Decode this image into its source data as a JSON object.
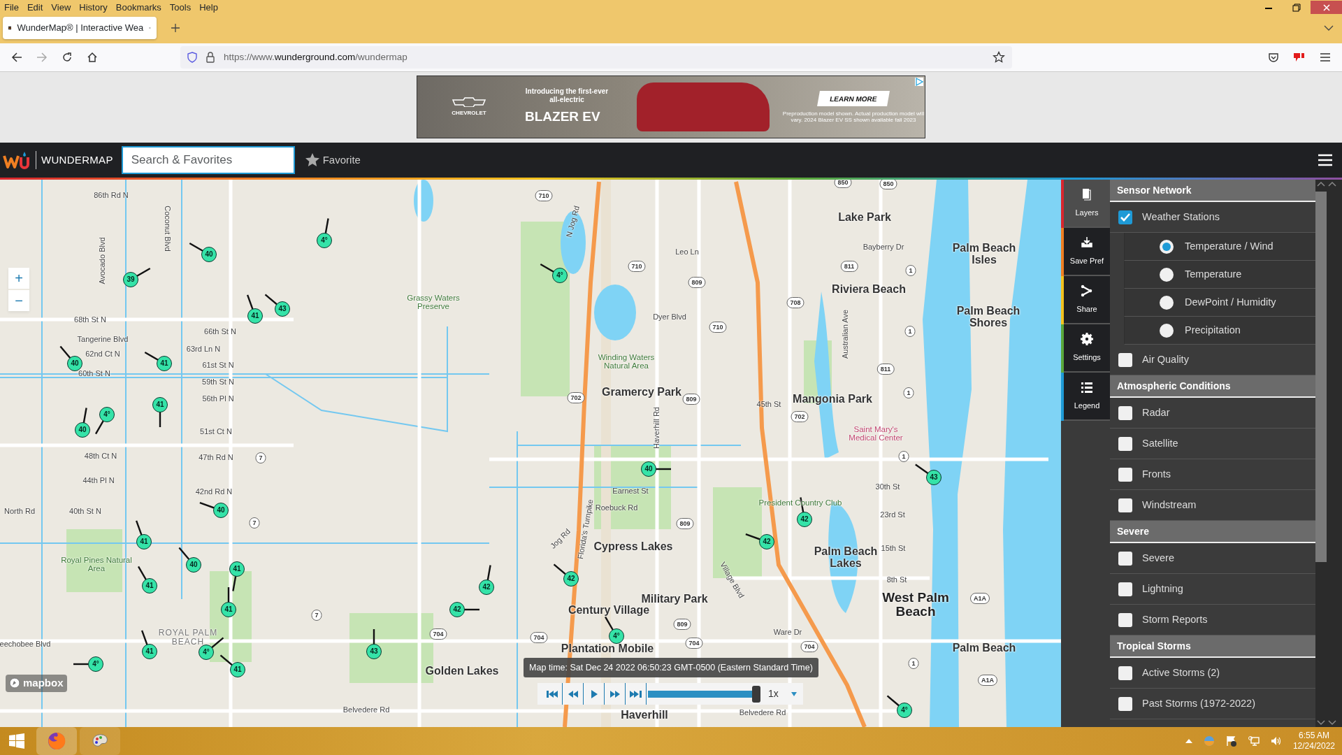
{
  "browser": {
    "menu": [
      "File",
      "Edit",
      "View",
      "History",
      "Bookmarks",
      "Tools",
      "Help"
    ],
    "tabs": [
      {
        "title": "WunderMap® | Interactive Wea",
        "selected": true
      }
    ],
    "url": {
      "prefix": "https://www.",
      "host": "wunderground.com",
      "path": "/wundermap"
    }
  },
  "ad": {
    "brand": "CHEVROLET",
    "headline": "Introducing the first-ever all-electric",
    "model": "BLAZER EV",
    "cta": "LEARN MORE",
    "fine_print": "Preproduction model shown. Actual production model will vary. 2024 Blazer EV SS shown available fall 2023"
  },
  "app": {
    "logo": "WUNDERMAP",
    "search": {
      "placeholder": "Search & Favorites"
    },
    "favorite": "Favorite"
  },
  "map": {
    "zoom": [
      "+",
      "−"
    ],
    "attribution": "mapbox",
    "places": [
      {
        "kind": "town",
        "text": "Lake Park"
      },
      {
        "kind": "suburb",
        "text": "Palm Beach Isles"
      },
      {
        "kind": "town",
        "text": "Riviera Beach"
      },
      {
        "kind": "park",
        "text": "Grassy Waters Preserve"
      },
      {
        "kind": "suburb",
        "text": "Palm Beach Shores"
      },
      {
        "kind": "park",
        "text": "Winding Waters Natural Area"
      },
      {
        "kind": "town",
        "text": "Gramercy Park"
      },
      {
        "kind": "town",
        "text": "Mangonia Park"
      },
      {
        "kind": "poi",
        "text": "Saint Mary's Medical Center"
      },
      {
        "kind": "club",
        "text": "President Country Club"
      },
      {
        "kind": "town",
        "text": "Cypress Lakes"
      },
      {
        "kind": "park",
        "text": "Royal Pines Natural Area"
      },
      {
        "kind": "suburb",
        "text": "Palm Beach Lakes"
      },
      {
        "kind": "town",
        "text": "Military Park"
      },
      {
        "kind": "town",
        "text": "Century Village"
      },
      {
        "kind": "city",
        "text": "West Palm Beach"
      },
      {
        "kind": "area",
        "text": "ROYAL PALM BEACH"
      },
      {
        "kind": "town",
        "text": "Plantation Mobile"
      },
      {
        "kind": "town",
        "text": "Palm Beach"
      },
      {
        "kind": "town",
        "text": "Golden Lakes"
      },
      {
        "kind": "town",
        "text": "Haverhill"
      }
    ],
    "streets": [
      "86th Rd N",
      "Coconut Blvd",
      "N Jog Rd",
      "Leo Ln",
      "Bayberry Dr",
      "Avocado Blvd",
      "68th St N",
      "Dyer Blvd",
      "Tangerine Blvd",
      "66th St N",
      "Australian Ave",
      "62nd Ct N",
      "63rd Ln N",
      "61st St N",
      "60th St N",
      "59th St N",
      "56th Pl N",
      "45th St",
      "51st Ct N",
      "Haverhill Rd",
      "48th Ct N",
      "47th Rd N",
      "44th Pl N",
      "42nd Rd N",
      "Earnest St",
      "30th St",
      "North Rd",
      "40th St N",
      "Roebuck Rd",
      "23rd St",
      "Jog Rd",
      "Florida's Turnpike",
      "15th St",
      "Village Blvd",
      "8th St",
      "Ware Dr",
      "eechobee Blvd",
      "Belvedere Rd",
      "Belvedere Rd"
    ],
    "shields": [
      "710",
      "710",
      "809",
      "710",
      "702",
      "809",
      "702",
      "708",
      "811",
      "1",
      "1",
      "811",
      "1",
      "1",
      "7",
      "7",
      "7",
      "809",
      "809",
      "704",
      "704",
      "704",
      "704",
      "A1A",
      "A1A",
      "1",
      "850",
      "850"
    ],
    "stations": [
      "40",
      "39",
      "4°",
      "43",
      "41",
      "40",
      "41",
      "41",
      "4°",
      "40",
      "40",
      "41",
      "40",
      "41",
      "41",
      "41",
      "41",
      "4°",
      "41",
      "4°",
      "43",
      "4°",
      "40",
      "43",
      "42",
      "42",
      "42",
      "42",
      "42",
      "4°",
      "4°"
    ]
  },
  "player": {
    "map_time": "Map time: Sat Dec 24 2022 06:50:23 GMT-0500 (Eastern Standard Time)",
    "level": 0.97,
    "speed": "1x"
  },
  "tools": [
    {
      "label": "Layers",
      "selected": true,
      "color": "#d9262e"
    },
    {
      "label": "Save Pref",
      "selected": false,
      "color": "#f07f22"
    },
    {
      "label": "Share",
      "selected": false,
      "color": "#f3c21d"
    },
    {
      "label": "Settings",
      "selected": false,
      "color": "#5aa83c"
    },
    {
      "label": "Legend",
      "selected": false,
      "color": "#1e9ad6"
    }
  ],
  "layers": [
    {
      "kind": "header",
      "label": "Sensor Network"
    },
    {
      "kind": "checkbox",
      "label": "Weather Stations",
      "checked": true
    },
    {
      "kind": "radio",
      "label": "Temperature / Wind",
      "selected": true
    },
    {
      "kind": "radio",
      "label": "Temperature",
      "selected": false
    },
    {
      "kind": "radio",
      "label": "DewPoint / Humidity",
      "selected": false
    },
    {
      "kind": "radio",
      "label": "Precipitation",
      "selected": false
    },
    {
      "kind": "checkbox",
      "label": "Air Quality",
      "checked": false
    },
    {
      "kind": "header",
      "label": "Atmospheric Conditions"
    },
    {
      "kind": "checkbox",
      "label": "Radar",
      "checked": false
    },
    {
      "kind": "checkbox",
      "label": "Satellite",
      "checked": false
    },
    {
      "kind": "checkbox",
      "label": "Fronts",
      "checked": false
    },
    {
      "kind": "checkbox",
      "label": "Windstream",
      "checked": false
    },
    {
      "kind": "header",
      "label": "Severe"
    },
    {
      "kind": "checkbox",
      "label": "Severe",
      "checked": false
    },
    {
      "kind": "checkbox",
      "label": "Lightning",
      "checked": false
    },
    {
      "kind": "checkbox",
      "label": "Storm Reports",
      "checked": false
    },
    {
      "kind": "header",
      "label": "Tropical Storms"
    },
    {
      "kind": "checkbox",
      "label": "Active Storms (2)",
      "checked": false
    },
    {
      "kind": "checkbox",
      "label": "Past Storms (1972-2022)",
      "checked": false
    }
  ],
  "taskbar": {
    "time": "6:55 AM",
    "date": "12/24/2022"
  }
}
